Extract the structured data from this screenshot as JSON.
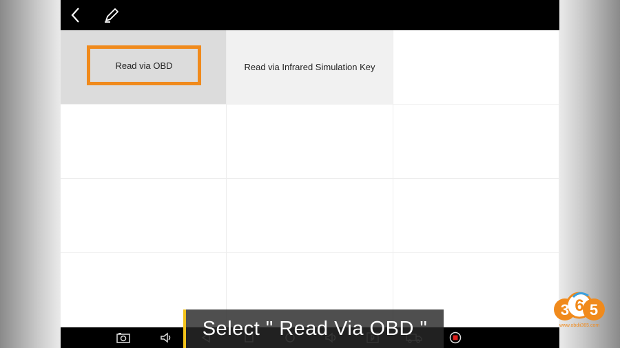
{
  "topbar": {
    "back_icon": "chevron-left-icon",
    "edit_icon": "pencil-icon"
  },
  "options": {
    "read_via_obd": "Read via OBD",
    "read_via_infrared": "Read via Infrared Simulation Key"
  },
  "caption": {
    "text": "Select \" Read Via OBD \""
  },
  "watermark": {
    "digits": "365",
    "site": "www.obdii365.com"
  },
  "navbar": {
    "icons": [
      "screenshot-icon",
      "volume-down-icon",
      "back-icon",
      "home-icon",
      "recent-apps-icon",
      "volume-up-icon",
      "bluetooth-icon",
      "truck-icon",
      "record-icon"
    ]
  },
  "colors": {
    "highlight": "#f08a1c",
    "caption_bar_accent": "#f2c21a",
    "record": "#e0201c"
  }
}
